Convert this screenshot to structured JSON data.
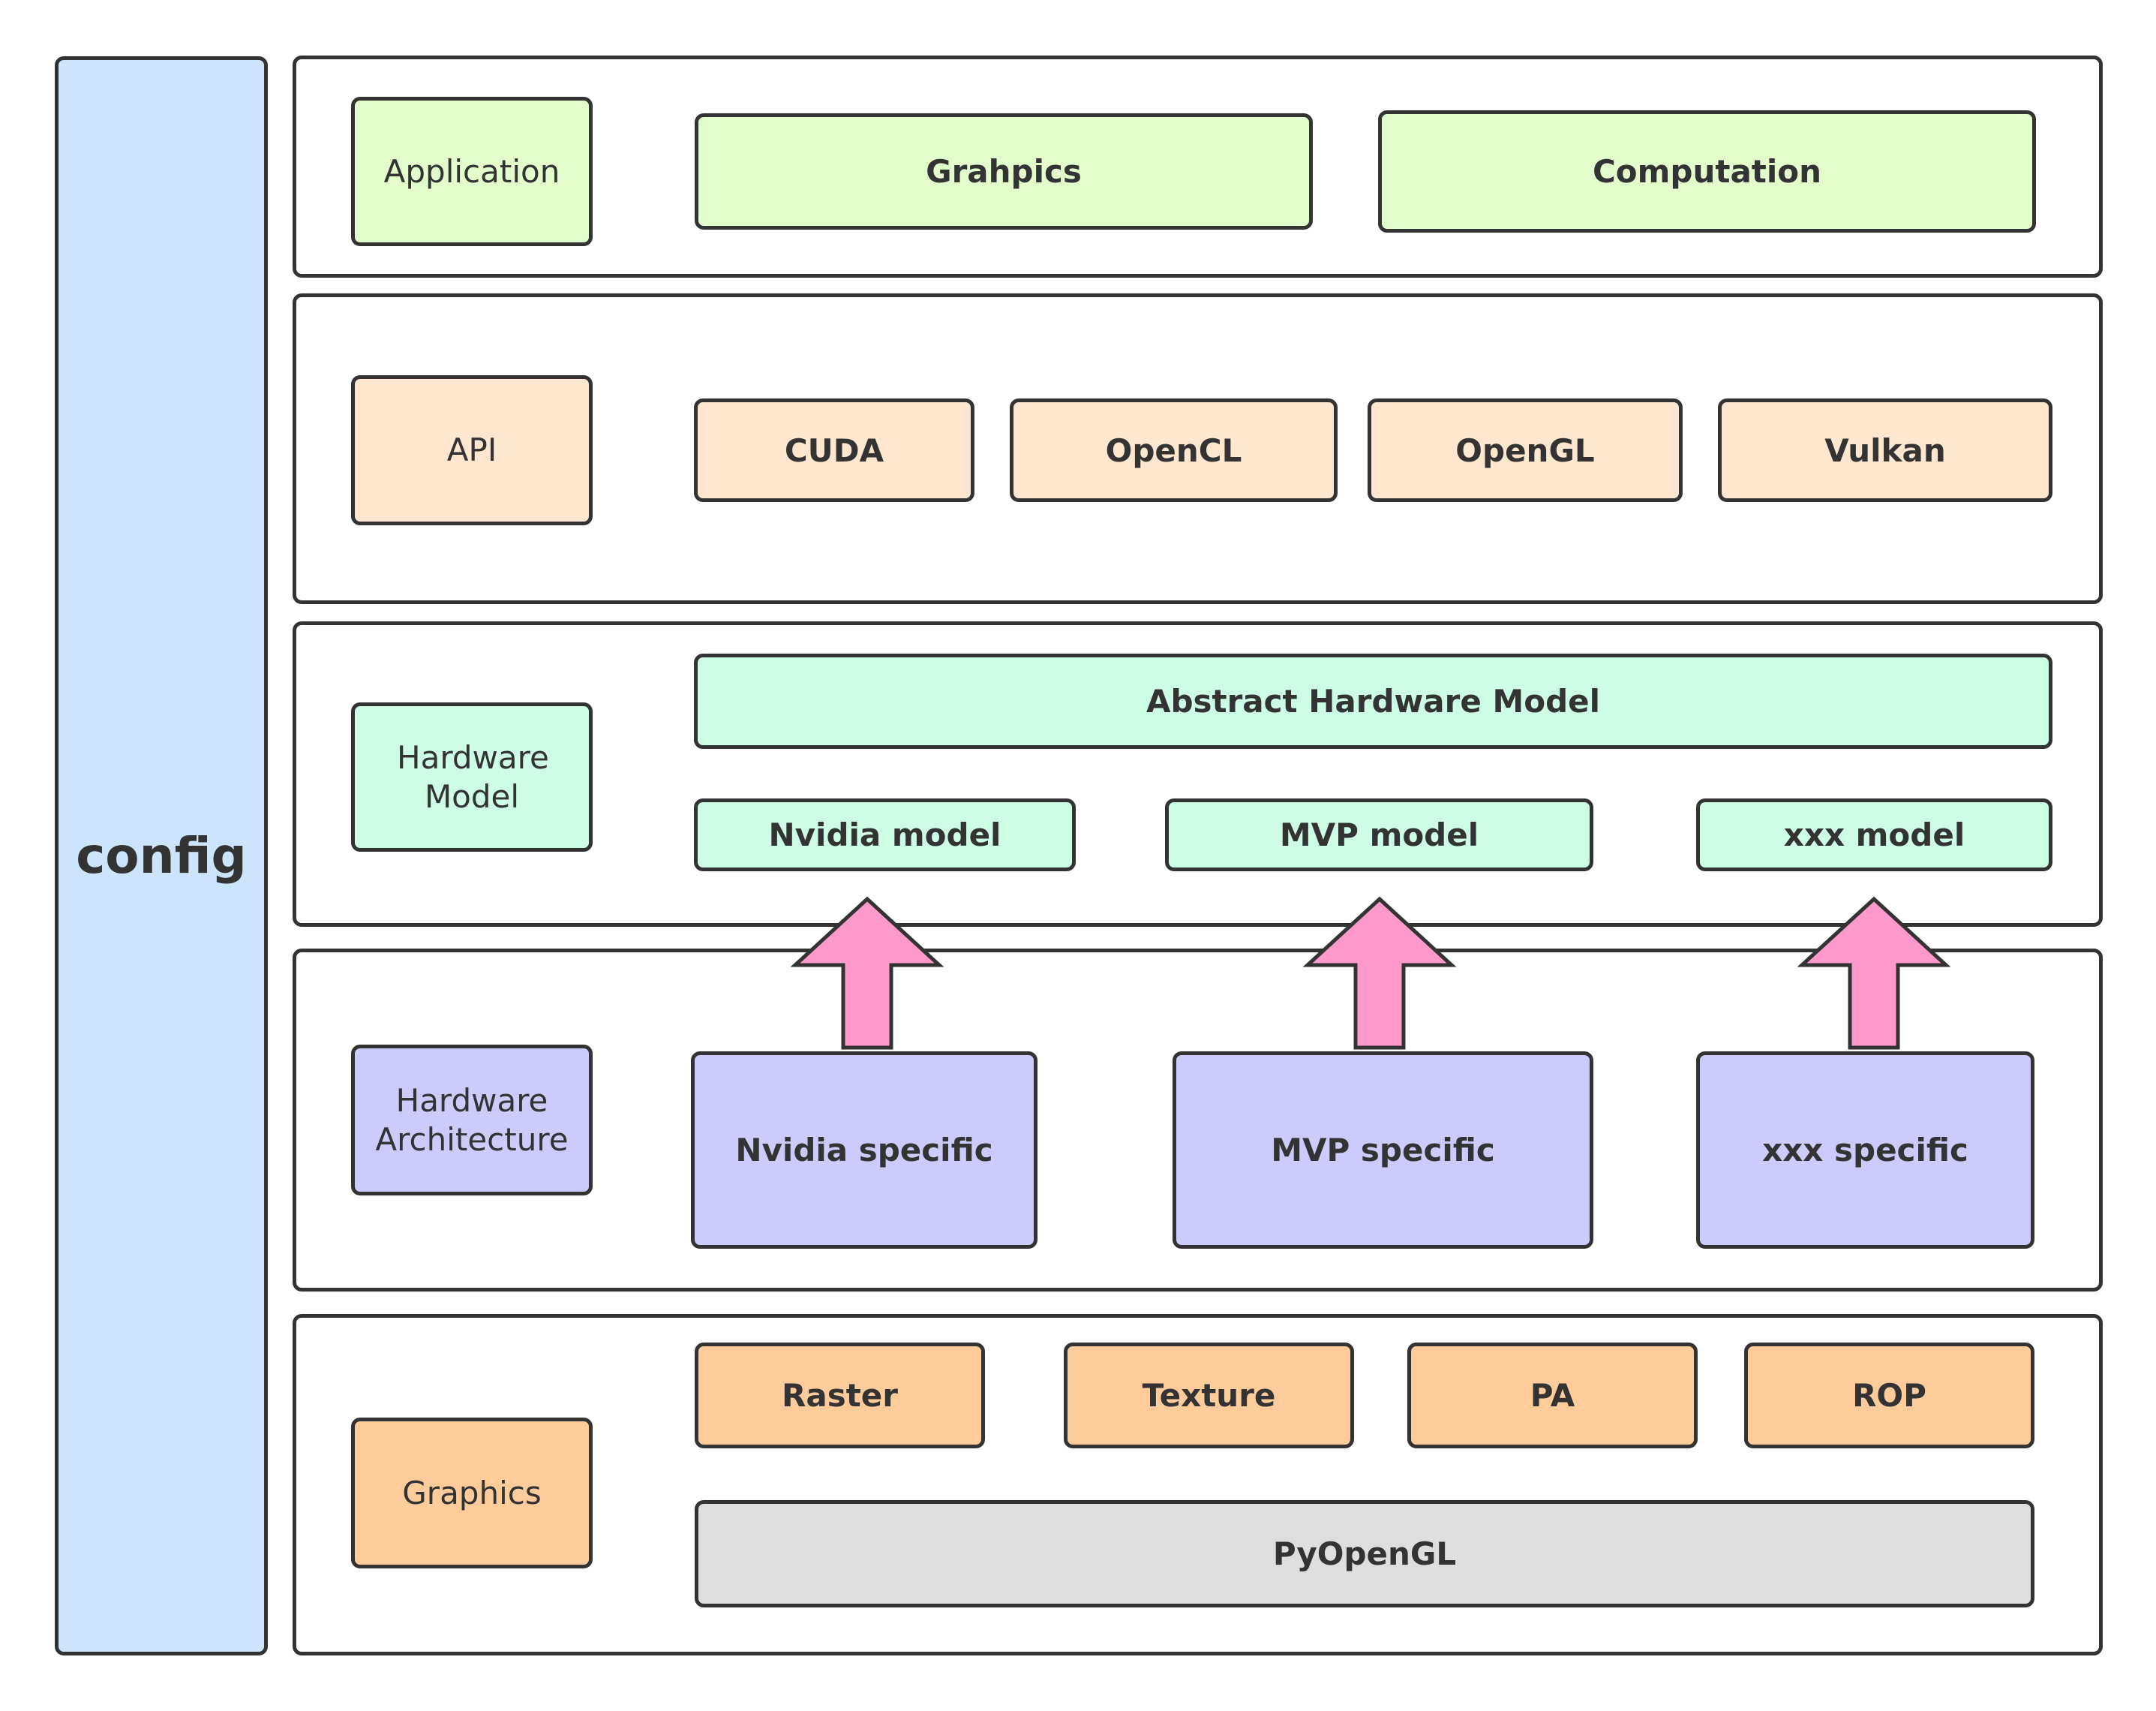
{
  "colors": {
    "border": "#333333",
    "config": "#cce5fd",
    "application": "#e3fccc",
    "api": "#fee6cf",
    "hardware_model": "#cdfde5",
    "hardware_architecture": "#cccbfb",
    "graphics": "#fecc9a",
    "pyopengl": "#dedede",
    "arrow": "#fd9acb"
  },
  "config": {
    "label": "config"
  },
  "layers": {
    "application": {
      "label": "Application",
      "items": [
        "Grahpics",
        "Computation"
      ]
    },
    "api": {
      "label": "API",
      "items": [
        "CUDA",
        "OpenCL",
        "OpenGL",
        "Vulkan"
      ]
    },
    "hardware_model": {
      "label": "Hardware Model",
      "abstract": "Abstract Hardware Model",
      "items": [
        "Nvidia model",
        "MVP model",
        "xxx model"
      ]
    },
    "hardware_architecture": {
      "label": "Hardware Architecture",
      "items": [
        "Nvidia specific",
        "MVP specific",
        "xxx specific"
      ]
    },
    "graphics": {
      "label": "Graphics",
      "items": [
        "Raster",
        "Texture",
        "PA",
        "ROP"
      ],
      "base": "PyOpenGL"
    }
  },
  "arrows": [
    {
      "from": "Nvidia specific",
      "to": "Nvidia model",
      "direction": "up"
    },
    {
      "from": "MVP specific",
      "to": "MVP model",
      "direction": "up"
    },
    {
      "from": "xxx specific",
      "to": "xxx model",
      "direction": "up"
    }
  ]
}
